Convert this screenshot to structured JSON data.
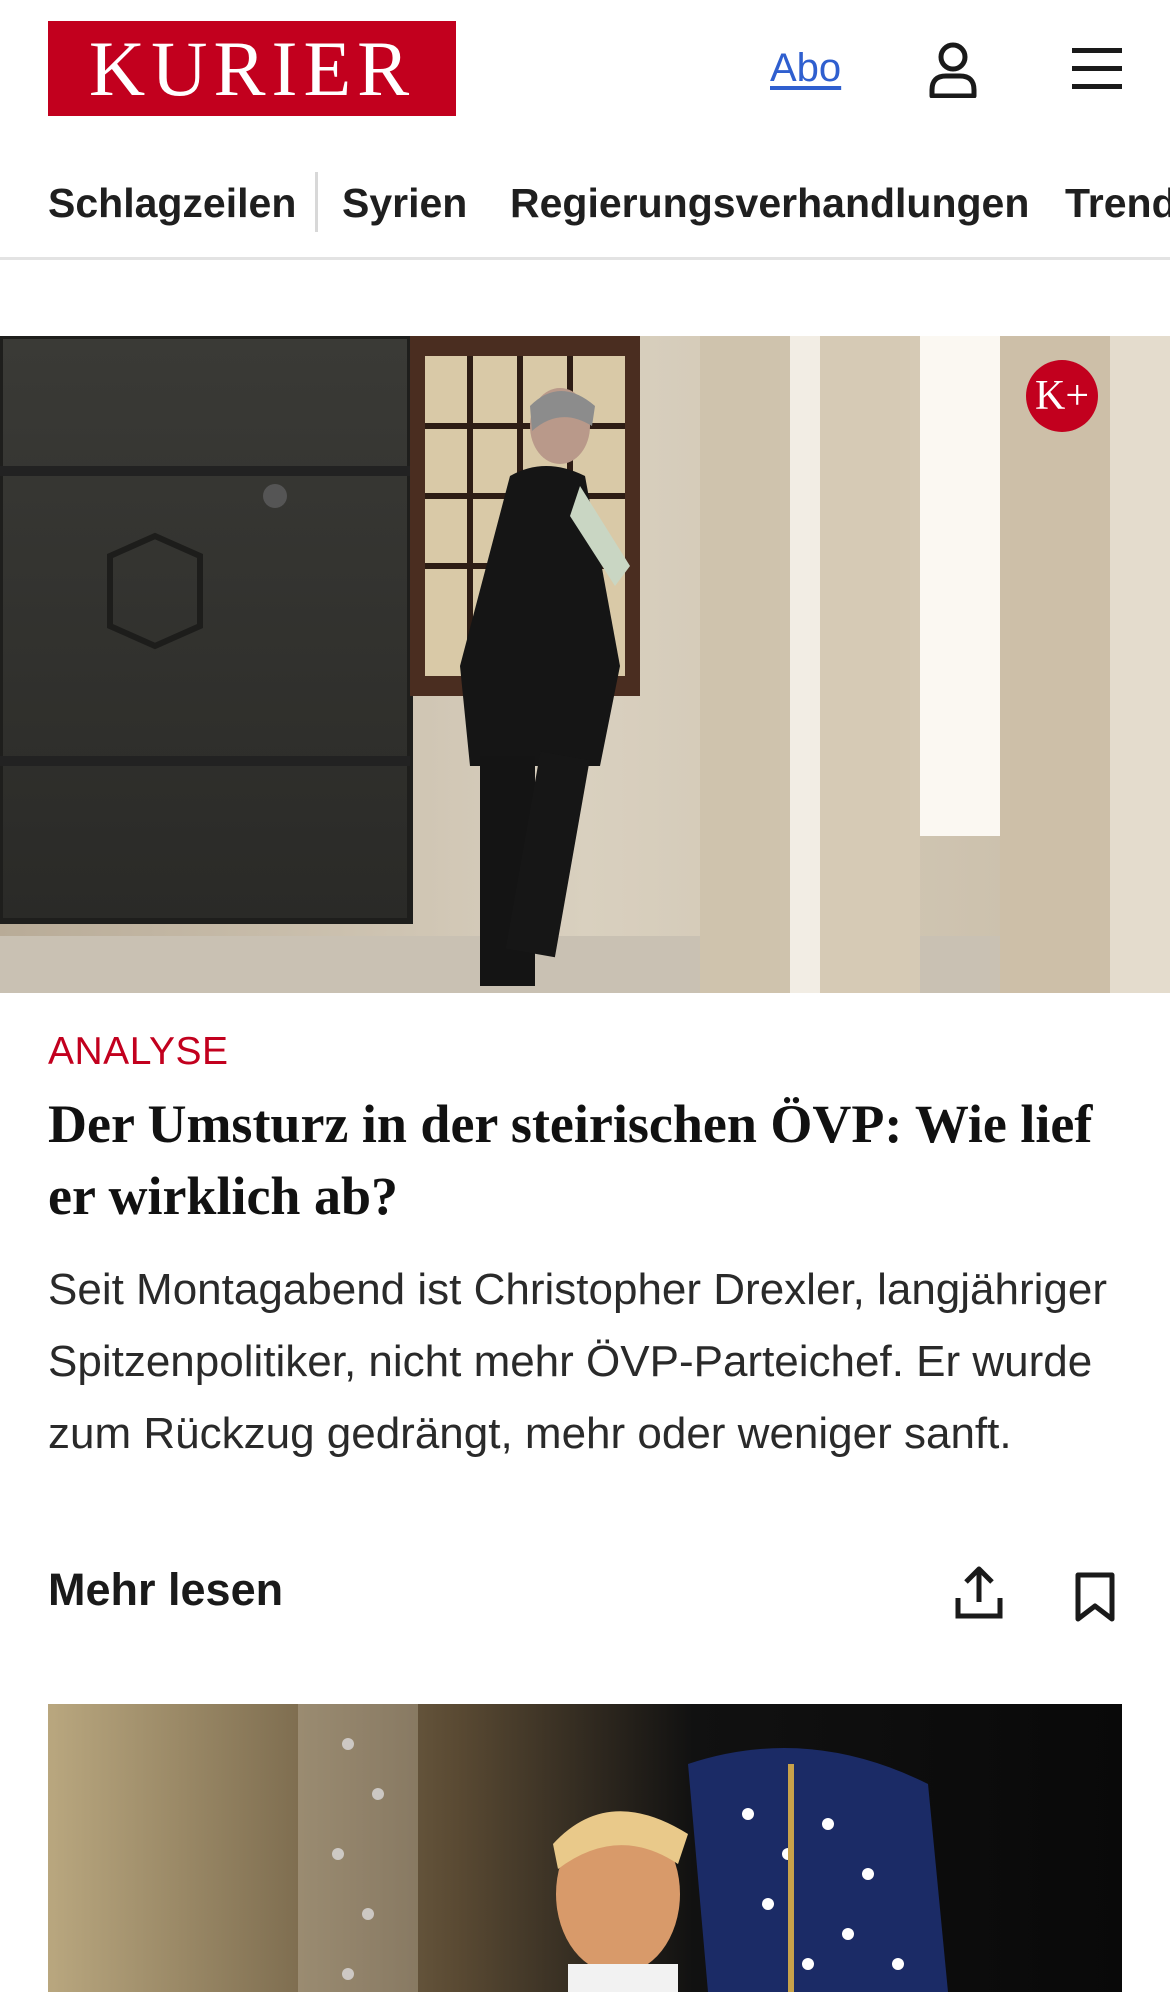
{
  "header": {
    "logo_text": "KURIER",
    "abo_label": "Abo",
    "user_icon": "user-icon",
    "menu_icon": "hamburger-menu-icon",
    "brand_color": "#c2001e",
    "link_color": "#2f5fcf"
  },
  "nav": {
    "items": [
      {
        "label": "Schlagzeilen"
      },
      {
        "label": "Syrien"
      },
      {
        "label": "Regierungsverhandlungen"
      },
      {
        "label": "Trend"
      }
    ]
  },
  "article": {
    "badge": "K+",
    "kicker": "ANALYSE",
    "headline": "Der Umsturz in der steirischen ÖVP: Wie lief er wirklich ab?",
    "teaser": "Seit Montagabend ist Christopher Drexler, langjähriger Spitzenpolitiker, nicht mehr ÖVP-Parteichef. Er wurde zum Rückzug gedrängt, mehr oder weniger sanft.",
    "more_label": "Mehr lesen",
    "share_icon": "share-icon",
    "bookmark_icon": "bookmark-icon"
  }
}
